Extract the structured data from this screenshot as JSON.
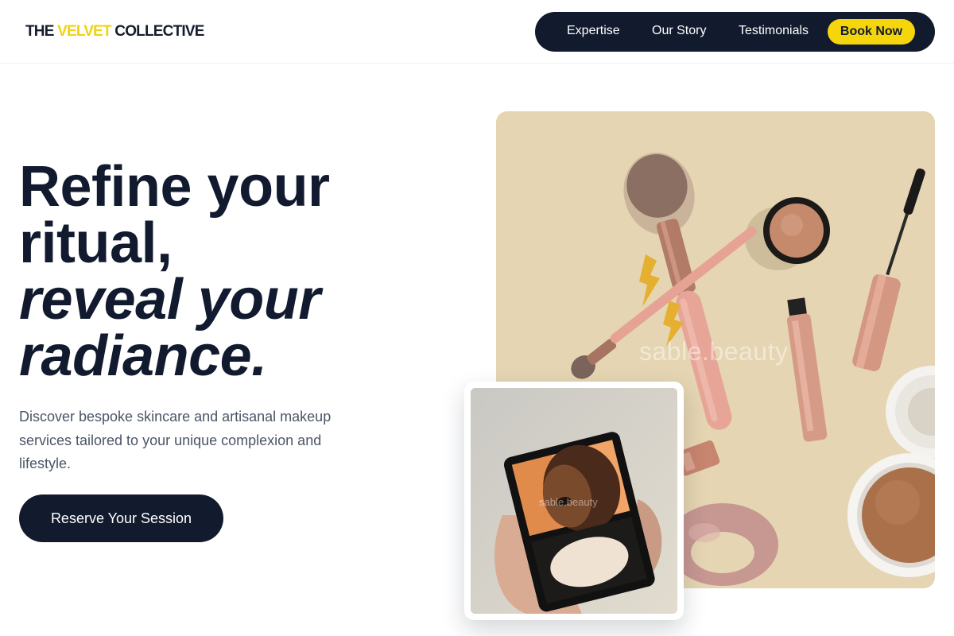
{
  "brand": {
    "logo_prefix": "THE ",
    "logo_accent": "VELVET",
    "logo_suffix": " COLLECTIVE",
    "accent_color": "#f5d50c",
    "dark_color": "#121a2d"
  },
  "nav": {
    "items": [
      {
        "label": "Expertise"
      },
      {
        "label": "Our Story"
      },
      {
        "label": "Testimonials"
      }
    ],
    "cta_label": "Book Now"
  },
  "hero": {
    "headline_lines": [
      "Refine your",
      "ritual,",
      "reveal your",
      "radiance."
    ],
    "description": "Discover bespoke skincare and artisanal makeup services tailored to your unique complexion and lifestyle.",
    "cta_label": "Reserve Your Session"
  },
  "images": {
    "main_watermark": "sable.beauty",
    "float_watermark": "sable.beauty"
  }
}
